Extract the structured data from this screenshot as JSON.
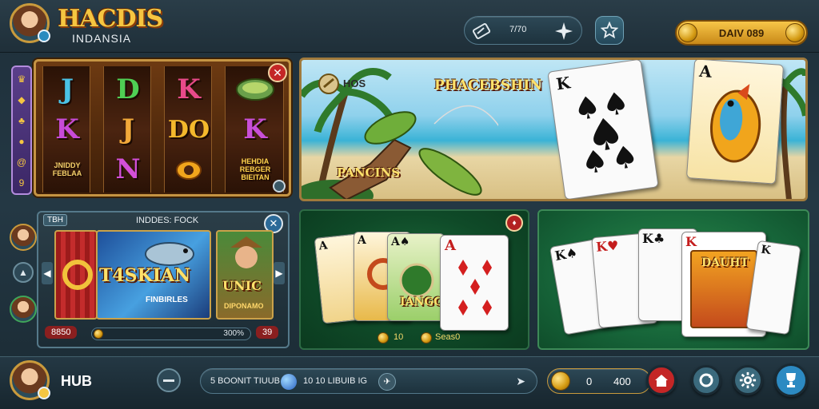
{
  "header": {
    "logo_title": "HACDIS",
    "logo_subtitle": "INDANSIA",
    "center_pill_text": "7/70",
    "balance_label": "DAIV 089"
  },
  "slot_panel": {
    "reels": [
      [
        "J",
        "K",
        "JNIDDY FEBLAA"
      ],
      [
        "D",
        "J",
        "N"
      ],
      [
        "K",
        "DO",
        ""
      ],
      [
        "",
        "K",
        "HEHDIA REBGER BIEITAN"
      ]
    ]
  },
  "fishing_banner": {
    "hub_label": "HOS",
    "title": "PHACEBSHIN",
    "caption": "PANCINS"
  },
  "game_carousel": {
    "header_left": "TBH",
    "header_title": "INDDES: FOCK",
    "tiles": [
      "T4SKIAN",
      "FINBIRLES",
      "UNIC",
      "DIPONAMO"
    ],
    "left_value": "8850",
    "right_value": "300%",
    "far_right_value": "39"
  },
  "card_table_1": {
    "center_tile_label": "IANGC",
    "footer_text": "10",
    "footer_text_2": "Seas0"
  },
  "card_table_2": {
    "card_label": "DAUHT"
  },
  "footer": {
    "player_name": "HUB",
    "search_text": "5 BOONIT TIUUB",
    "search_text_2": "10 10 LIBUIB IG",
    "coins_value": "0",
    "coins_value_2": "400"
  },
  "colors": {
    "gold": "#f5c641",
    "red_close": "#c42626",
    "felt_green": "#17663a",
    "bar_teal": "#243844"
  }
}
